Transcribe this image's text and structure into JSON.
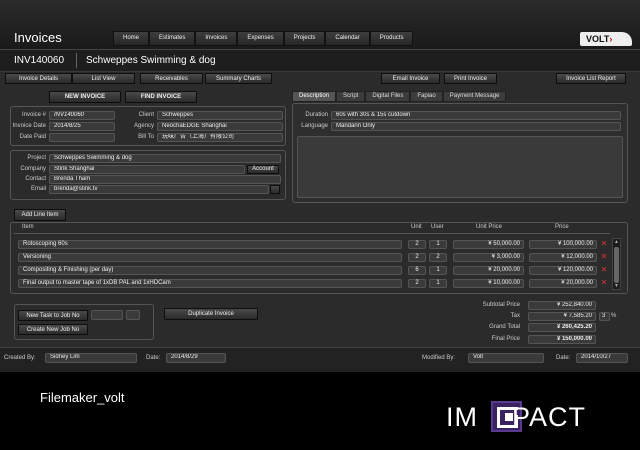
{
  "app": {
    "title": "Invoices"
  },
  "nav": [
    "Home",
    "Estimates",
    "Invoices",
    "Expenses",
    "Projects",
    "Calendar",
    "Products"
  ],
  "logo": {
    "text": "VOLT"
  },
  "invoice_header": {
    "number": "INV140060",
    "name": "Schweppes Swimming & dog"
  },
  "toolbar": {
    "invoice_details": "Invoice Details",
    "list_view": "List View",
    "receivables": "Receivables",
    "summary_charts": "Summary Charts",
    "email_invoice": "Email Invoice",
    "print_invoice": "Print Invoice",
    "invoice_list_report": "Invoice List Report"
  },
  "actions": {
    "new_invoice": "NEW INVOICE",
    "find_invoice": "FIND INVOICE"
  },
  "details": {
    "invoice_no_label": "Invoice #",
    "invoice_no": "INV140060",
    "invoice_date_label": "Invoice Date",
    "invoice_date": "2014/8/25",
    "date_paid_label": "Date Paid",
    "date_paid": "",
    "client_label": "Client",
    "client": "Schweppes",
    "agency_label": "Agency",
    "agency": "NeochaEDGE Shanghai",
    "bill_to_label": "Bill To",
    "bill_to": "玩味广告（上海）有限公司"
  },
  "contact": {
    "project_label": "Project",
    "project": "Schweppes Swimming & dog",
    "company_label": "Company",
    "company": "Stink Shanghai",
    "account_button": "Account",
    "contact_label": "Contact",
    "contact": "Brenda Tham",
    "email_label": "Email",
    "email": "brenda@stink.tv"
  },
  "tabs": [
    "Description",
    "Script",
    "Digital Files",
    "Fapiao",
    "Payment Message"
  ],
  "description": {
    "duration_label": "Duration",
    "duration": "60s with 30s & 15s cutdown",
    "language_label": "Language",
    "language": "Mandarin Only"
  },
  "line_items": {
    "add_button": "Add Line Item",
    "headers": {
      "item": "Item",
      "unit": "Unit",
      "user": "User",
      "unit_price": "Unit Price",
      "price": "Price"
    },
    "rows": [
      {
        "item": "Rotoscoping 60s",
        "unit": "2",
        "user": "1",
        "unit_price": "¥ 50,000.00",
        "price": "¥ 100,000.00"
      },
      {
        "item": "Versioning",
        "unit": "2",
        "user": "2",
        "unit_price": "¥ 3,000.00",
        "price": "¥ 12,000.00"
      },
      {
        "item": "Compositing & Finishing (per day)",
        "unit": "6",
        "user": "1",
        "unit_price": "¥ 20,000.00",
        "price": "¥ 120,000.00"
      },
      {
        "item": "Final output to master tape of 1xDB PAL and 1xHDCam",
        "unit": "2",
        "user": "1",
        "unit_price": "¥ 10,000.00",
        "price": "¥ 20,000.00"
      }
    ],
    "delete_glyph": "✕"
  },
  "tasks": {
    "new_task_button": "New Task to Job No",
    "new_job_button": "Create New Job No",
    "duplicate_button": "Duplicate Invoice"
  },
  "totals": {
    "subtotal_label": "Subtotal Price",
    "subtotal": "¥ 252,840.00",
    "tax_label": "Tax",
    "tax": "¥ 7,585.20",
    "tax_rate": "3",
    "tax_unit": "%",
    "grand_total_label": "Grand Total",
    "grand_total": "¥ 260,425.20",
    "final_price_label": "Final Price",
    "final_price": "¥ 150,000.00"
  },
  "footer": {
    "created_by_label": "Created By:",
    "created_by": "Sidney Lim",
    "created_date_label": "Date:",
    "created_date": "2014/8/29",
    "modified_by_label": "Modified By:",
    "modified_by": "Volt",
    "modified_date_label": "Date:",
    "modified_date": "2014/10/27"
  },
  "caption": "Filemaker_volt",
  "branding": {
    "left": "IM",
    "right": "PACT"
  },
  "colors": {
    "delete": "#dd3333",
    "brand_purple": "#3a2160"
  }
}
